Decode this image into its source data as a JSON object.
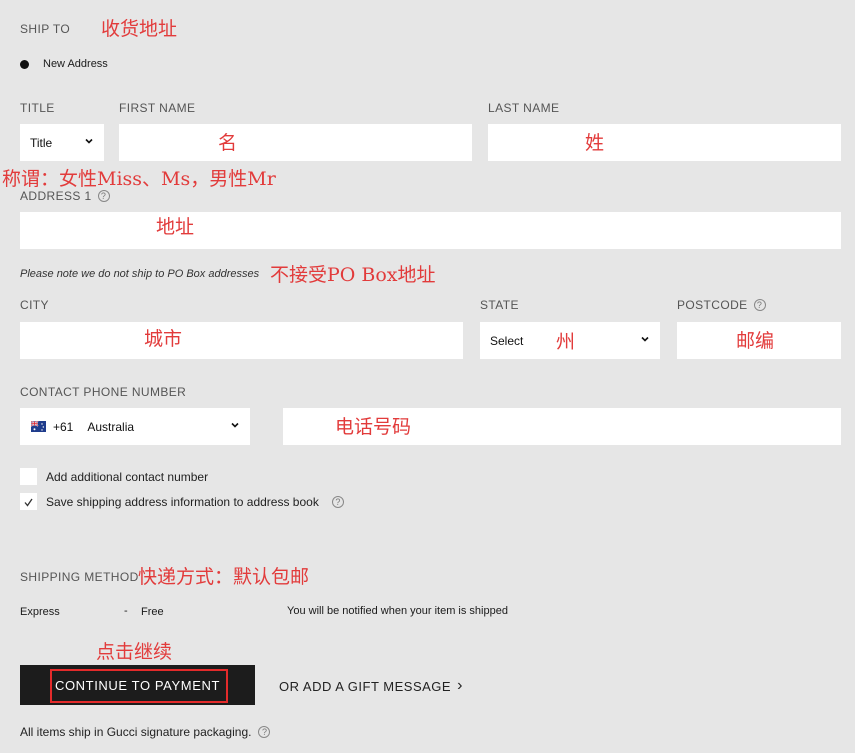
{
  "ship_to": {
    "label": "SHIP TO",
    "annotation": "收货地址",
    "new_address_label": "New Address"
  },
  "name_row": {
    "title_label": "TITLE",
    "first_name_label": "FIRST NAME",
    "last_name_label": "LAST NAME",
    "title_select_value": "Title",
    "first_name_annotation": "名",
    "last_name_annotation": "姓",
    "title_annotation": "称谓：女性Miss、Ms，男性Mr"
  },
  "address": {
    "label": "ADDRESS 1",
    "annotation": "地址",
    "note": "Please note we do not ship to PO Box addresses",
    "note_annotation": "不接受PO Box地址"
  },
  "city_row": {
    "city_label": "CITY",
    "city_annotation": "城市",
    "state_label": "STATE",
    "state_select_value": "Select",
    "state_annotation": "州",
    "postcode_label": "POSTCODE",
    "postcode_annotation": "邮编"
  },
  "phone": {
    "label": "CONTACT PHONE NUMBER",
    "country_code": "+61",
    "country_name": "Australia",
    "number_annotation": "电话号码"
  },
  "options": {
    "additional_contact_label": "Add additional contact number",
    "additional_contact_checked": false,
    "save_address_label": "Save shipping address information to address book",
    "save_address_checked": true
  },
  "shipping_method": {
    "label": "SHIPPING METHOD",
    "annotation": "快递方式：默认包邮",
    "method_name": "Express",
    "separator": "-",
    "price": "Free",
    "notice": "You will be notified when your item is shipped"
  },
  "actions": {
    "click_annotation": "点击继续",
    "continue_label": "CONTINUE TO PAYMENT",
    "gift_message_label": "OR ADD A GIFT MESSAGE",
    "gift_chevron": "›"
  },
  "footer": {
    "packaging_note": "All items ship in Gucci signature packaging."
  },
  "icons": {
    "help": "?",
    "chevron_down": "chevron-down-icon",
    "flag": "australia-flag-icon"
  },
  "colors": {
    "background": "#e6e6e6",
    "annotation_red": "#e23b3b",
    "button_dark": "#1c1c1c",
    "highlight_box": "#e32b2b"
  }
}
